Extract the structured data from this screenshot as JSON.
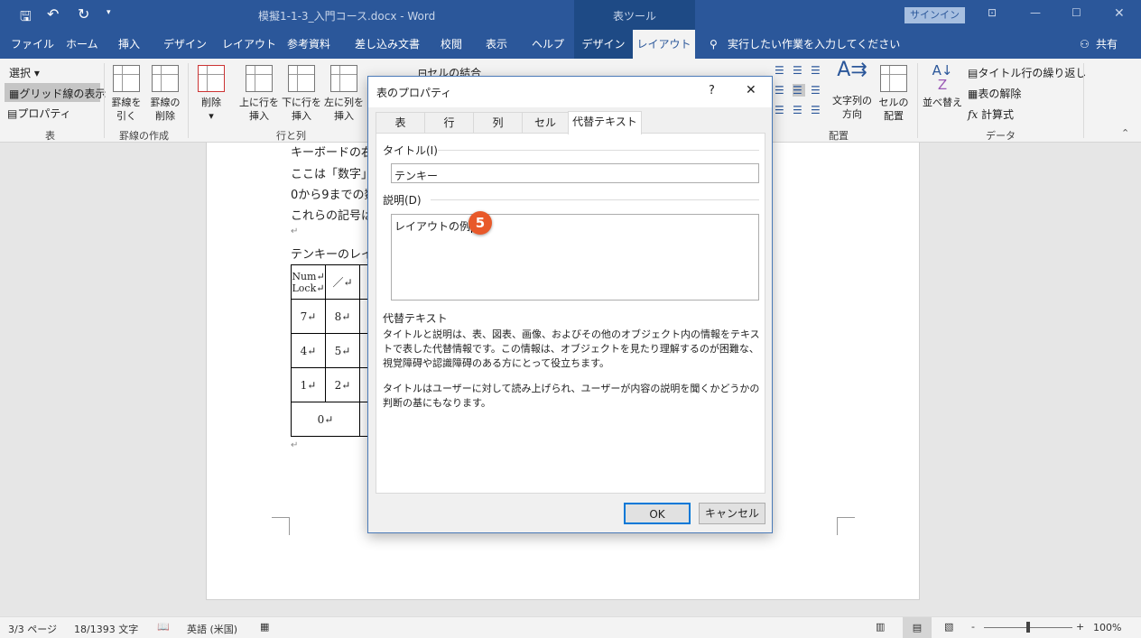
{
  "titlebar": {
    "doc_title": "模擬1-1-3_入門コース.docx  -  Word",
    "context_tools": "表ツール",
    "signin": "サインイン",
    "save_icon": "save-icon",
    "undo_icon": "undo-icon",
    "redo_icon": "redo-icon",
    "customize": "▾",
    "ribbon_display": "⊡",
    "minimize": "—",
    "maximize": "☐",
    "close": "✕"
  },
  "tabs": [
    {
      "label": "ファイル"
    },
    {
      "label": "ホーム"
    },
    {
      "label": "挿入"
    },
    {
      "label": "デザイン"
    },
    {
      "label": "レイアウト"
    },
    {
      "label": "参考資料"
    },
    {
      "label": "差し込み文書"
    },
    {
      "label": "校閲"
    },
    {
      "label": "表示"
    },
    {
      "label": "ヘルプ"
    },
    {
      "label": "デザイン"
    },
    {
      "label": "レイアウト"
    }
  ],
  "tellme": "実行したい作業を入力してください",
  "share": "共有",
  "ribbon": {
    "table": {
      "select": "選択 ▾",
      "gridlines": "グリッド線の表示",
      "properties": "プロパティ",
      "label": "表"
    },
    "draw": {
      "draw_table": "罫線を\n引く",
      "eraser": "罫線の\n削除",
      "label": "罫線の作成"
    },
    "rows": {
      "delete": "削除",
      "delete_arrow": "▾",
      "above": "上に行を\n挿入",
      "below": "下に行を\n挿入",
      "left": "左に列を\n挿入",
      "label": "行と列"
    },
    "merge": {
      "merge_cells": "セルの結合"
    },
    "align": {
      "text_direction": "文字列の\n方向",
      "margins": "セルの\n配置",
      "label": "配置"
    },
    "data": {
      "sort": "並べ替え",
      "repeat_header": "タイトル行の繰り返し",
      "convert": "表の解除",
      "formula": "計算式",
      "label": "データ"
    },
    "collapse": "⌃"
  },
  "document": {
    "lines": [
      "キーボードの右",
      "ここは「数字」を",
      "0から9までの数",
      "これらの記号は",
      "↵",
      "テンキーのレイ"
    ],
    "table": [
      [
        "Num↵\nLock↵",
        "／↵"
      ],
      [
        "7↵",
        "8↵"
      ],
      [
        "4↵",
        "5↵"
      ],
      [
        "1↵",
        "2↵"
      ],
      [
        "0↵"
      ]
    ],
    "end_mark": "↵"
  },
  "dialog": {
    "title": "表のプロパティ",
    "help": "?",
    "close": "✕",
    "tabs": [
      "表",
      "行",
      "列",
      "セル",
      "代替テキスト"
    ],
    "active_tab": 4,
    "title_label": "タイトル(I)",
    "title_value": "テンキー",
    "desc_label": "説明(D)",
    "desc_value": "レイアウトの例",
    "step_badge": "5",
    "badge_color": "#e8592a",
    "help_heading": "代替テキスト",
    "help_p1": "タイトルと説明は、表、図表、画像、およびその他のオブジェクト内の情報をテキストで表した代替情報です。この情報は、オブジェクトを見たり理解するのが困難な、視覚障碍や認識障碍のある方にとって役立ちます。",
    "help_p2": "タイトルはユーザーに対して読み上げられ、ユーザーが内容の説明を聞くかどうかの判断の基にもなります。",
    "ok": "OK",
    "cancel": "キャンセル"
  },
  "status": {
    "page": "3/3 ページ",
    "words": "18/1393 文字",
    "language": "英語 (米国)",
    "zoom": "100%",
    "zoom_level": 100
  },
  "colors": {
    "brand": "#2b579a",
    "context": "#1e4a85"
  }
}
